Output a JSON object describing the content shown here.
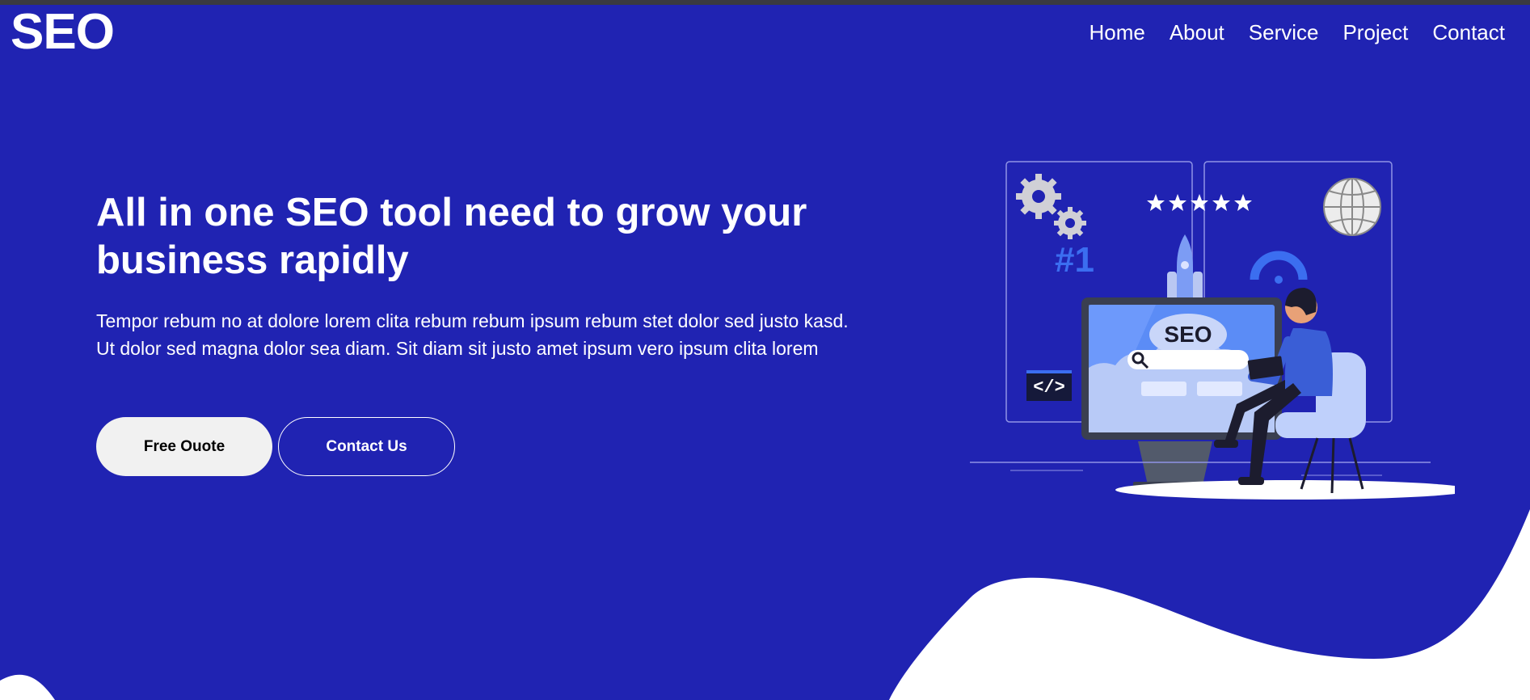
{
  "brand": {
    "logo": "SEO"
  },
  "nav": {
    "items": [
      "Home",
      "About",
      "Service",
      "Project",
      "Contact"
    ]
  },
  "hero": {
    "title": "All in one SEO tool need to grow your business rapidly",
    "text": "Tempor rebum no at dolore lorem clita rebum rebum ipsum rebum stet dolor sed justo kasd. Ut dolor sed magna dolor sea diam. Sit diam sit justo amet ipsum vero ipsum clita lorem",
    "primary_button": "Free Ouote",
    "secondary_button": "Contact Us"
  },
  "illustration": {
    "monitor_label": "SEO",
    "rank_badge": "#1",
    "code_badge": "</>",
    "rating_stars": 5
  },
  "colors": {
    "background": "#2023b2",
    "primary_button_bg": "#f1f1f1",
    "wave": "#ffffff",
    "illustration_accent": "#3b6ef0"
  }
}
